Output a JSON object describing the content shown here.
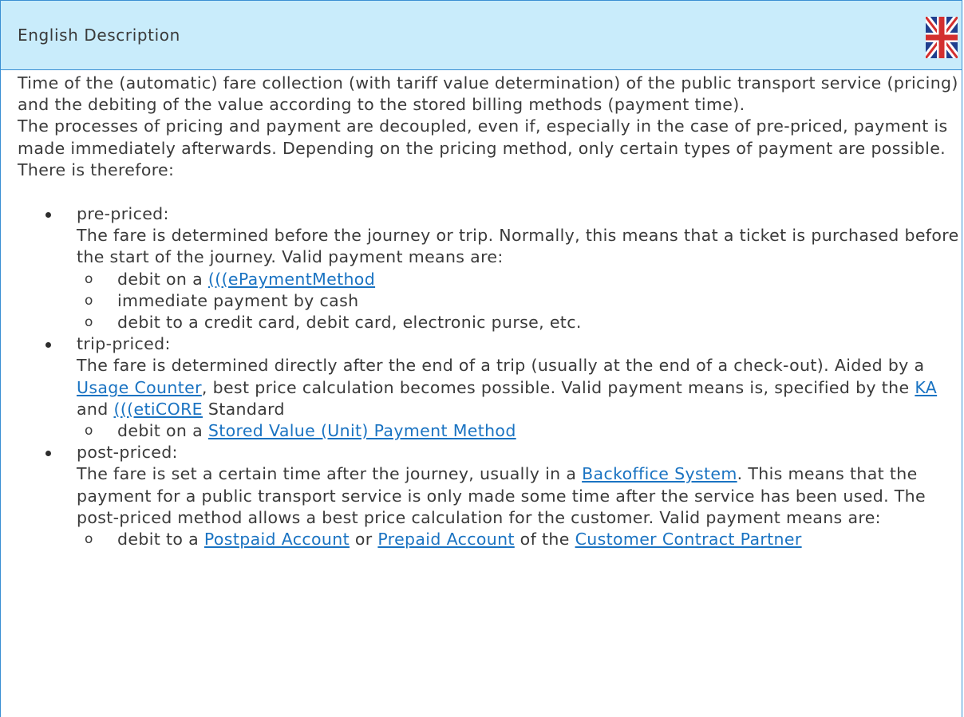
{
  "header": {
    "title": "English Description",
    "flag_icon": "uk-flag-icon"
  },
  "intro": [
    "Time of the (automatic) fare collection (with tariff value determination) of the public transport service (pricing) and the debiting of the value according to the stored billing methods (payment time).",
    "The processes of pricing and payment are decoupled, even if, especially in the case of pre-priced, payment is made immediately afterwards. Depending on the pricing method, only certain types of payment are possible.",
    "There is therefore:"
  ],
  "items": {
    "pre": {
      "title": "pre-priced:",
      "desc": "The fare is determined before the journey or trip. Normally, this means that a ticket is purchased before the start of the journey. Valid payment means are:",
      "sub1_text": "debit on a ",
      "sub1_link": "(((ePaymentMethod",
      "sub2": "immediate payment by cash",
      "sub3": "debit to a credit card, debit card, electronic purse, etc."
    },
    "trip": {
      "title": "trip-priced:",
      "desc_a": "The fare is determined directly after the end of a trip (usually at the end of a check-out). Aided by a ",
      "link_usage": "Usage Counter",
      "desc_b": ", best price calculation becomes possible. Valid payment means is, specified by the ",
      "link_ka": "KA",
      "desc_c": " and ",
      "link_eticore": "(((etiCORE",
      "desc_d": " Standard",
      "sub1_text": "debit on a ",
      "sub1_link": "Stored Value (Unit) Payment Method"
    },
    "post": {
      "title": "post-priced:",
      "desc_a": "The fare is set a certain time after the journey, usually in a ",
      "link_backoffice": "Backoffice System",
      "desc_b": ". This means that the payment for a public transport service is only made some time after the service has been used. The post-priced method allows a best price calculation for the customer. Valid payment means are:",
      "sub1_text_a": "debit to a ",
      "sub1_link_postpaid": "Postpaid Account",
      "sub1_text_b": " or ",
      "sub1_link_prepaid": "Prepaid Account",
      "sub1_text_c": " of the ",
      "sub1_link_customer": "Customer Contract Partner"
    }
  }
}
